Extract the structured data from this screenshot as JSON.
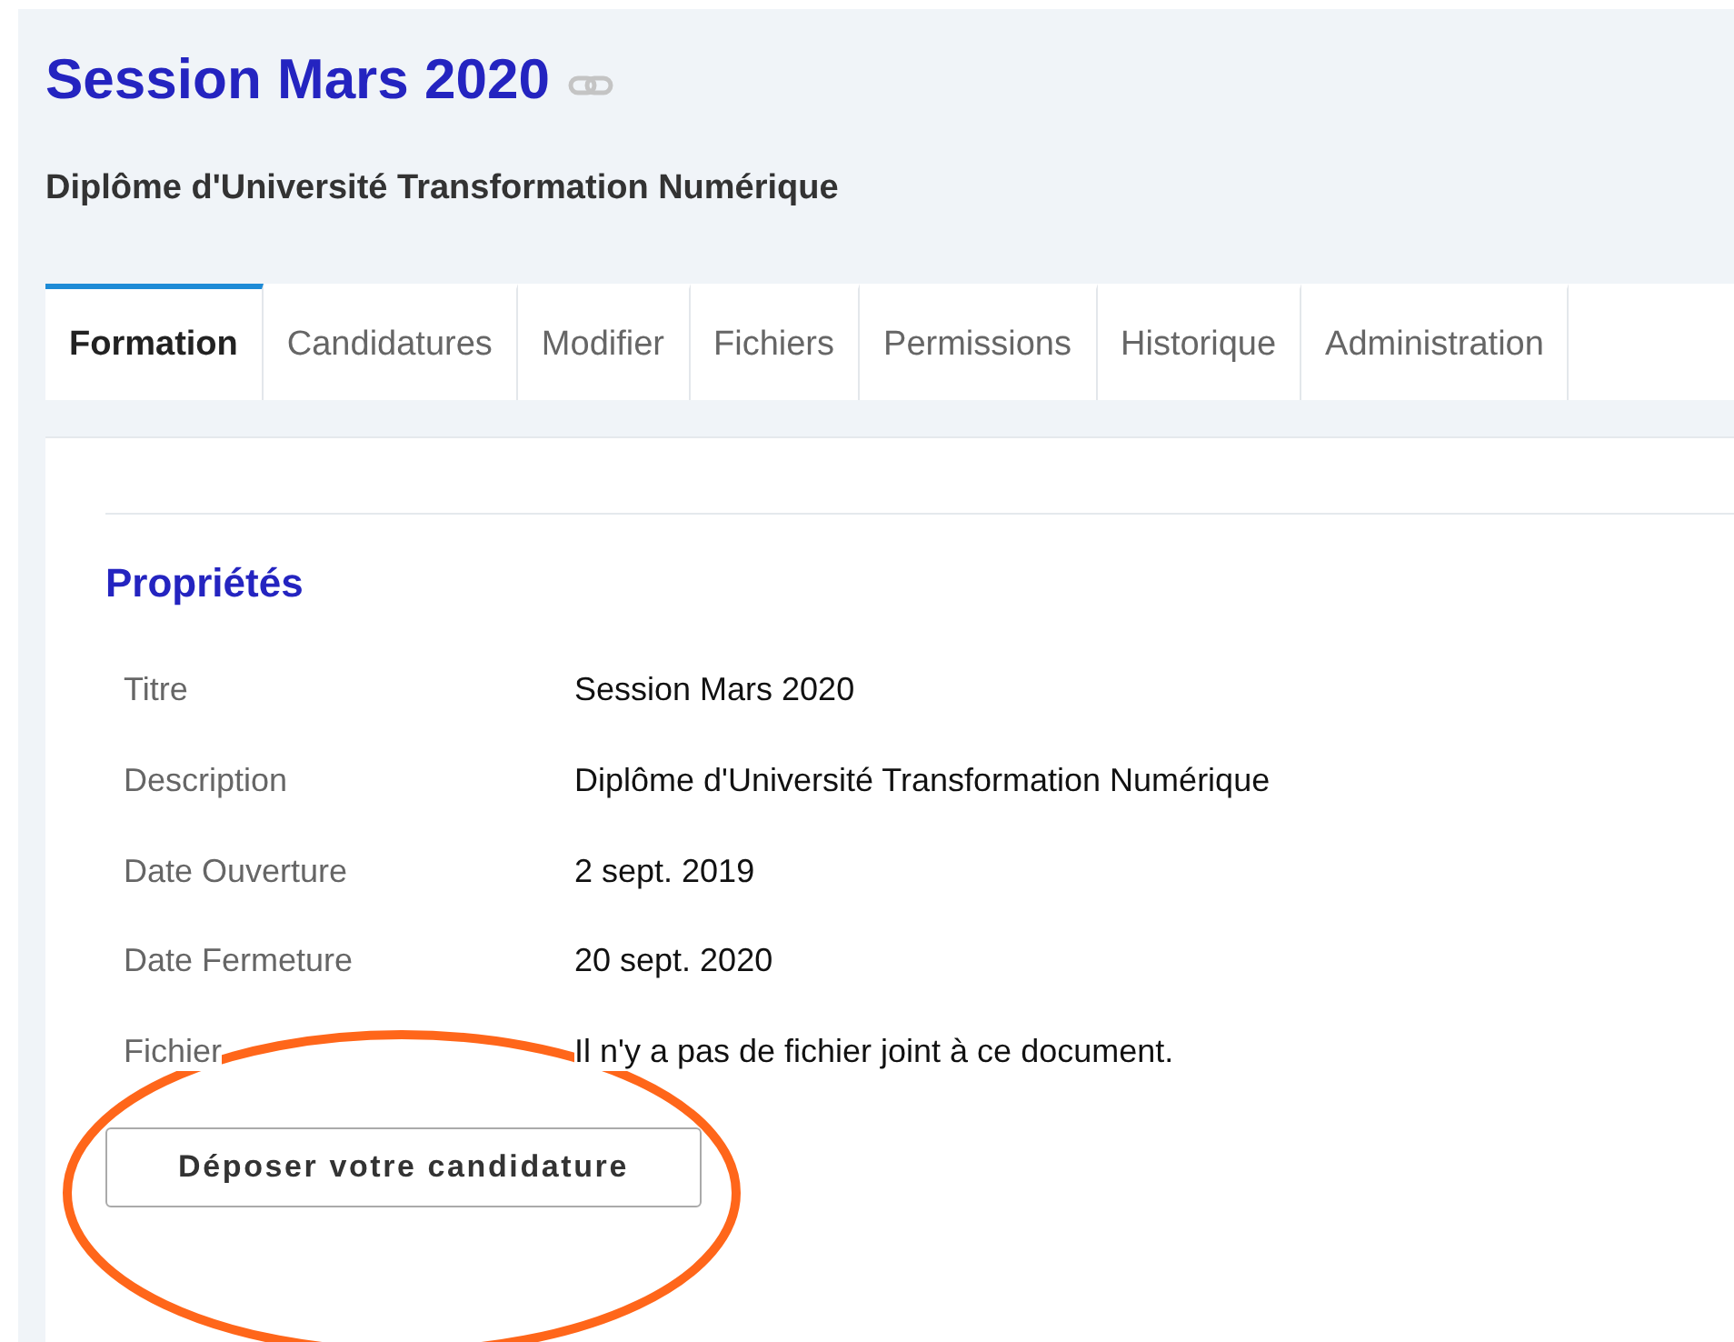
{
  "page": {
    "title": "Session Mars 2020",
    "subtitle": "Diplôme d'Université Transformation Numérique"
  },
  "tabs": [
    {
      "label": "Formation",
      "selected": true
    },
    {
      "label": "Candidatures",
      "selected": false
    },
    {
      "label": "Modifier",
      "selected": false
    },
    {
      "label": "Fichiers",
      "selected": false
    },
    {
      "label": "Permissions",
      "selected": false
    },
    {
      "label": "Historique",
      "selected": false
    },
    {
      "label": "Administration",
      "selected": false
    }
  ],
  "properties": {
    "heading": "Propriétés",
    "rows": [
      {
        "label": "Titre",
        "value": "Session Mars 2020"
      },
      {
        "label": "Description",
        "value": "Diplôme d'Université Transformation Numérique"
      },
      {
        "label": "Date Ouverture",
        "value": "2 sept. 2019"
      },
      {
        "label": "Date Fermeture",
        "value": "20 sept. 2020"
      },
      {
        "label": "Fichier",
        "value": "Il n'y a pas de fichier joint à ce document."
      }
    ]
  },
  "button": "Déposer votre candidature",
  "annotations": [
    {
      "kind": "ellipse"
    }
  ]
}
